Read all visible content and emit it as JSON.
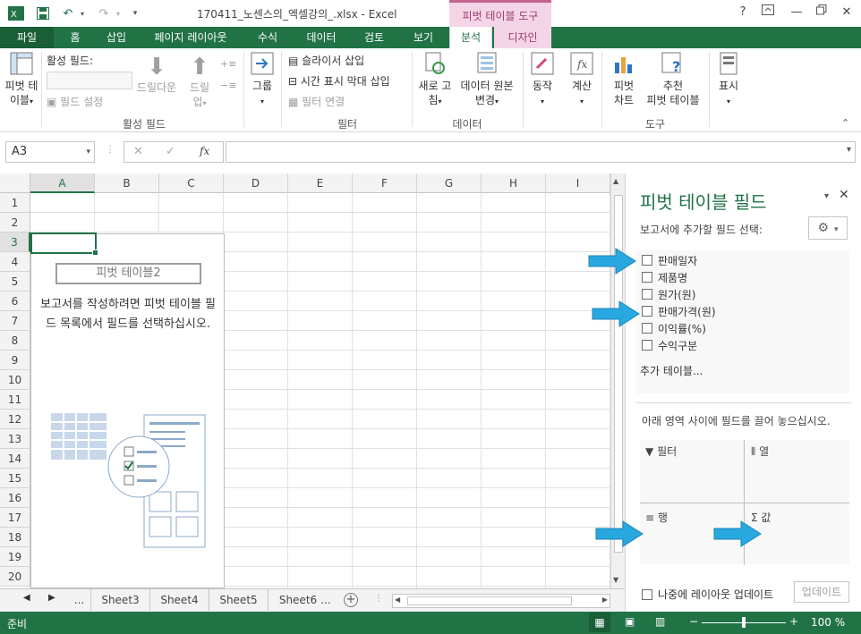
{
  "window": {
    "title": "170411_노센스의_엑셀강의_.xlsx - Excel",
    "context_tab_title": "피벗 테이블 도구",
    "help": "?",
    "minimize": "—",
    "close": "✕"
  },
  "tabs": [
    "파일",
    "홈",
    "삽입",
    "페이지 레이아웃",
    "수식",
    "데이터",
    "검토",
    "보기",
    "분석",
    "디자인"
  ],
  "ribbon": {
    "pivot_table": "피벗 테",
    "pivot_table_2": "이블",
    "active_field_label": "활성 필드:",
    "field_settings": "필드 설정",
    "drill_down": "드릴다운",
    "drill_up": "드릴",
    "drill_up_2": "업",
    "group_active_field": "활성 필드",
    "grouping": "그룹",
    "slicer_insert": "슬라이서 삽입",
    "timeline_insert": "시간 표시 막대 삽입",
    "filter_connect": "필터 연결",
    "group_filter": "필터",
    "refresh": "새로 고",
    "refresh_2": "침",
    "change_source": "데이터 원본",
    "change_source_2": "변경",
    "group_data": "데이터",
    "actions": "동작",
    "calculations": "계산",
    "pivot_chart": "피벗",
    "pivot_chart_2": "차트",
    "recommended": "추천",
    "recommended_2": "피벗 테이블",
    "group_tools": "도구",
    "show": "표시"
  },
  "formula_bar": {
    "name_box": "A3",
    "cancel": "✕",
    "enter": "✓",
    "fx": "fx",
    "value": ""
  },
  "grid": {
    "columns": [
      "A",
      "B",
      "C",
      "D",
      "E",
      "F",
      "G",
      "H",
      "I"
    ],
    "rows": [
      "1",
      "2",
      "3",
      "4",
      "5",
      "6",
      "7",
      "8",
      "9",
      "10",
      "11",
      "12",
      "13",
      "14",
      "15",
      "16",
      "17",
      "18",
      "19",
      "20"
    ],
    "selected_cell": "A3"
  },
  "pivot_placeholder": {
    "name": "피벗 테이블2",
    "message": "보고서를 작성하려면 피벗 테이블 필드 목록에서 필드를 선택하십시오."
  },
  "sheets": {
    "ellipsis": "...",
    "tabs": [
      "Sheet3",
      "Sheet4",
      "Sheet5",
      "Sheet6"
    ],
    "ellipsis_after": "..."
  },
  "status": {
    "ready": "준비",
    "zoom": "100 %"
  },
  "pane": {
    "title": "피벗 테이블 필드",
    "subtitle": "보고서에 추가할 필드 선택:",
    "fields": [
      "판매일자",
      "제품명",
      "원가(원)",
      "판매가격(원)",
      "이익률(%)",
      "수익구분"
    ],
    "more_tables": "추가 테이블...",
    "drag_hint": "아래 영역 사이에 필드를 끌어 놓으십시오.",
    "area_filter": "필터",
    "area_columns": "열",
    "area_rows": "행",
    "area_values": "값",
    "defer_update": "나중에 레이아웃 업데이트",
    "update_button": "업데이트"
  },
  "colors": {
    "excel_green": "#217346",
    "arrow_blue": "#29a8e0",
    "context_pink": "#f4d5e5"
  }
}
